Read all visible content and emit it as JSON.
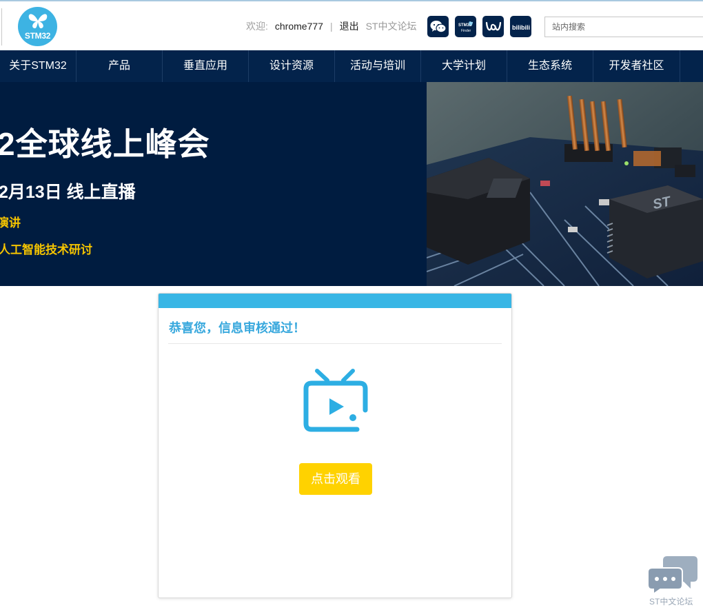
{
  "header": {
    "logo_text": "STM32",
    "welcome_label": "欢迎:",
    "username": "chrome777",
    "separator": "|",
    "logout_label": "退出",
    "forum_link": "ST中文论坛",
    "social_icons": [
      "wechat-icon",
      "stm32-finder-icon",
      "st-brand-icon",
      "bilibili-icon"
    ],
    "finder_icon_text": [
      "STM32",
      "Finder"
    ],
    "bilibili_icon_text": "bilibili",
    "search_placeholder": "站内搜索"
  },
  "nav": {
    "items": [
      "关于STM32",
      "产品",
      "垂直应用",
      "设计资源",
      "活动与培训",
      "大学计划",
      "生态系统",
      "开发者社区"
    ]
  },
  "banner": {
    "title": "2全球线上峰会",
    "date_line": "2月13日 线上直播",
    "line1": "演讲",
    "line2": "人工智能技术研讨",
    "chip_label": "ST"
  },
  "card": {
    "title": "恭喜您，信息审核通过！",
    "button_label": "点击观看"
  },
  "floating_widget": {
    "label": "ST中文论坛"
  },
  "colors": {
    "navy": "#03234b",
    "banner_bg": "#001c40",
    "accent_blue": "#38b6e5",
    "banner_yellow": "#f5c400",
    "button_yellow": "#ffd200"
  }
}
